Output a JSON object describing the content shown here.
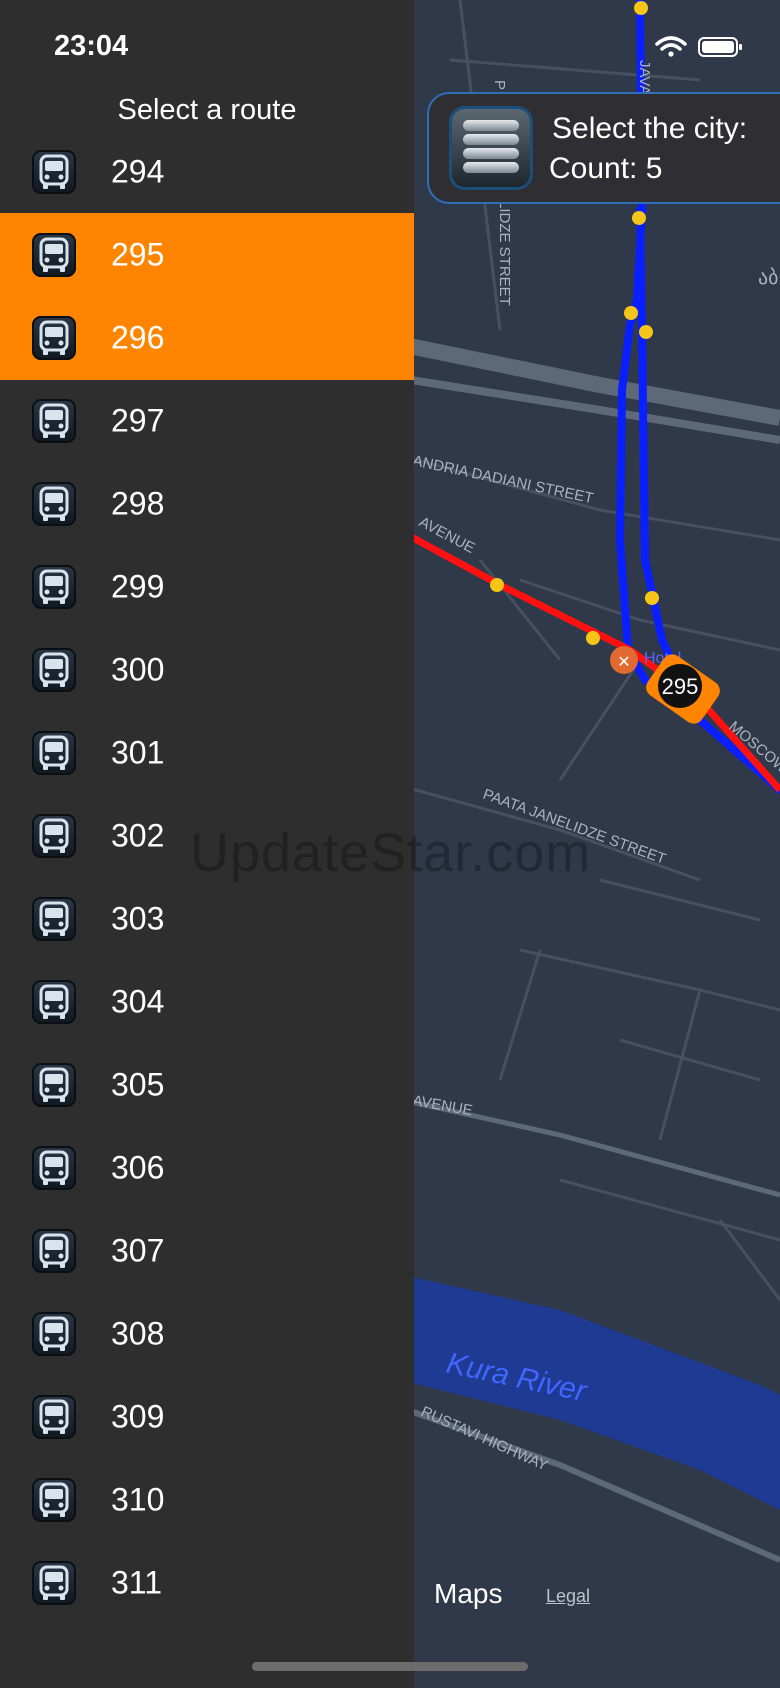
{
  "status_bar": {
    "time": "23:04"
  },
  "sidebar": {
    "title": "Select a route",
    "routes": [
      {
        "label": "294",
        "selected": false
      },
      {
        "label": "295",
        "selected": true
      },
      {
        "label": "296",
        "selected": true
      },
      {
        "label": "297",
        "selected": false
      },
      {
        "label": "298",
        "selected": false
      },
      {
        "label": "299",
        "selected": false
      },
      {
        "label": "300",
        "selected": false
      },
      {
        "label": "301",
        "selected": false
      },
      {
        "label": "302",
        "selected": false
      },
      {
        "label": "303",
        "selected": false
      },
      {
        "label": "304",
        "selected": false
      },
      {
        "label": "305",
        "selected": false
      },
      {
        "label": "306",
        "selected": false
      },
      {
        "label": "307",
        "selected": false
      },
      {
        "label": "308",
        "selected": false
      },
      {
        "label": "309",
        "selected": false
      },
      {
        "label": "310",
        "selected": false
      },
      {
        "label": "311",
        "selected": false
      }
    ],
    "selected_color": "#ff8400"
  },
  "city_card": {
    "title": "Select the city:",
    "count": "Count: 5"
  },
  "map": {
    "street_labels": {
      "javakh": "JAVAKH",
      "p_street": "P",
      "lidze_street": "LIDZE STREET",
      "dadiani": "ANDRIA DADIANI STREET",
      "avenue1": "AVENUE",
      "moscow": "MOSCOW",
      "janelidze": "PAATA JANELIDZE STREET",
      "avenue2": "AVENUE",
      "river": "Kura River",
      "rustavi": "RUSTAVI HIGHWAY",
      "poi": "Hotel",
      "georgian_text": "აბ"
    },
    "vehicle_label": "295",
    "route_colors": {
      "blue": "#0a1fff",
      "red": "#ff1111",
      "stop": "#f5c518"
    },
    "attribution": {
      "maps": "Maps",
      "legal": "Legal"
    }
  },
  "watermark": "UpdateStar.com"
}
